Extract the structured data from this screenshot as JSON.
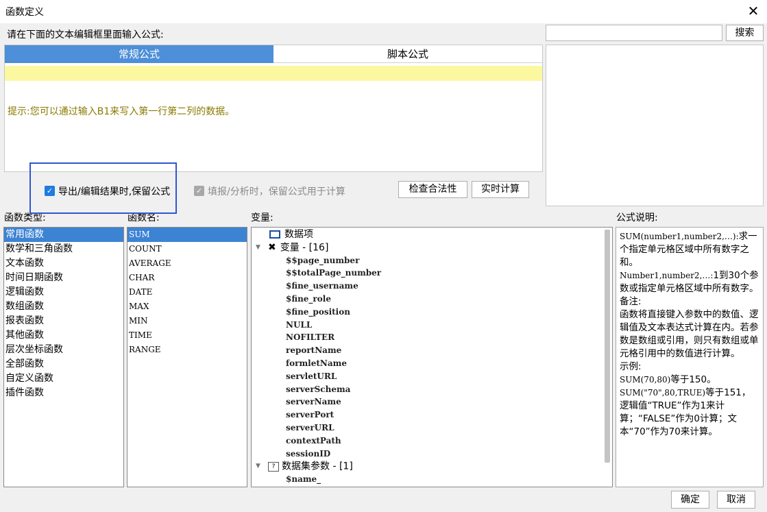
{
  "window": {
    "title": "函数定义",
    "close_glyph": "✕"
  },
  "prompt": "请在下面的文本编辑框里面输入公式:",
  "search": {
    "button": "搜索",
    "value": ""
  },
  "tabs": [
    {
      "label": "常规公式",
      "active": true
    },
    {
      "label": "脚本公式",
      "active": false
    }
  ],
  "editor": {
    "hint": "提示:您可以通过输入B1来写入第一行第二列的数据。"
  },
  "options": {
    "keep_formula_export": {
      "label": "导出/编辑结果时,保留公式",
      "checked": true
    },
    "keep_formula_fill": {
      "label": "填报/分析时，保留公式用于计算",
      "checked": true,
      "disabled": true
    }
  },
  "buttons": {
    "check": "检查合法性",
    "realtime": "实时计算",
    "ok": "确定",
    "cancel": "取消"
  },
  "sections": {
    "func_type": "函数类型:",
    "func_name": "函数名:",
    "variables": "变量:",
    "formula_desc": "公式说明:"
  },
  "func_types": [
    "常用函数",
    "数学和三角函数",
    "文本函数",
    "时间日期函数",
    "逻辑函数",
    "数组函数",
    "报表函数",
    "其他函数",
    "层次坐标函数",
    "全部函数",
    "自定义函数",
    "插件函数"
  ],
  "func_names": [
    "SUM",
    "COUNT",
    "AVERAGE",
    "CHAR",
    "DATE",
    "MAX",
    "MIN",
    "TIME",
    "RANGE"
  ],
  "variables": {
    "data_item": "数据项",
    "var_group": "变量 - [16]",
    "var_items": [
      "$$page_number",
      "$$totalPage_number",
      "$fine_username",
      "$fine_role",
      "$fine_position",
      "NULL",
      "NOFILTER",
      "reportName",
      "formletName",
      "servletURL",
      "serverSchema",
      "serverName",
      "serverPort",
      "serverURL",
      "contextPath",
      "sessionID"
    ],
    "ds_group": "数据集参数 - [1]",
    "ds_items": [
      "$name_"
    ]
  },
  "description": {
    "l1": "SUM(number1,number2,…):",
    "l1b": "求一个指定单元格区域中所有数字之和。",
    "l2": "Number1,number2,…:",
    "l2b": "1到30个参数或指定单元格区域中所有数字。",
    "l3": "备注:",
    "l4": "函数将直接键入参数中的数值、逻辑值及文本表达式计算在内。若参数是数组或引用，则只有数组或单元格引用中的数值进行计算。",
    "l5": "示例:",
    "l6a": "SUM(70,80)",
    "l6b": "等于150。",
    "l7a": "SUM(\"70\",80,TRUE)",
    "l7b": "等于151，逻辑值“TRUE”作为1来计算；“FALSE”作为0计算；文本“70”作为70来计算。"
  }
}
